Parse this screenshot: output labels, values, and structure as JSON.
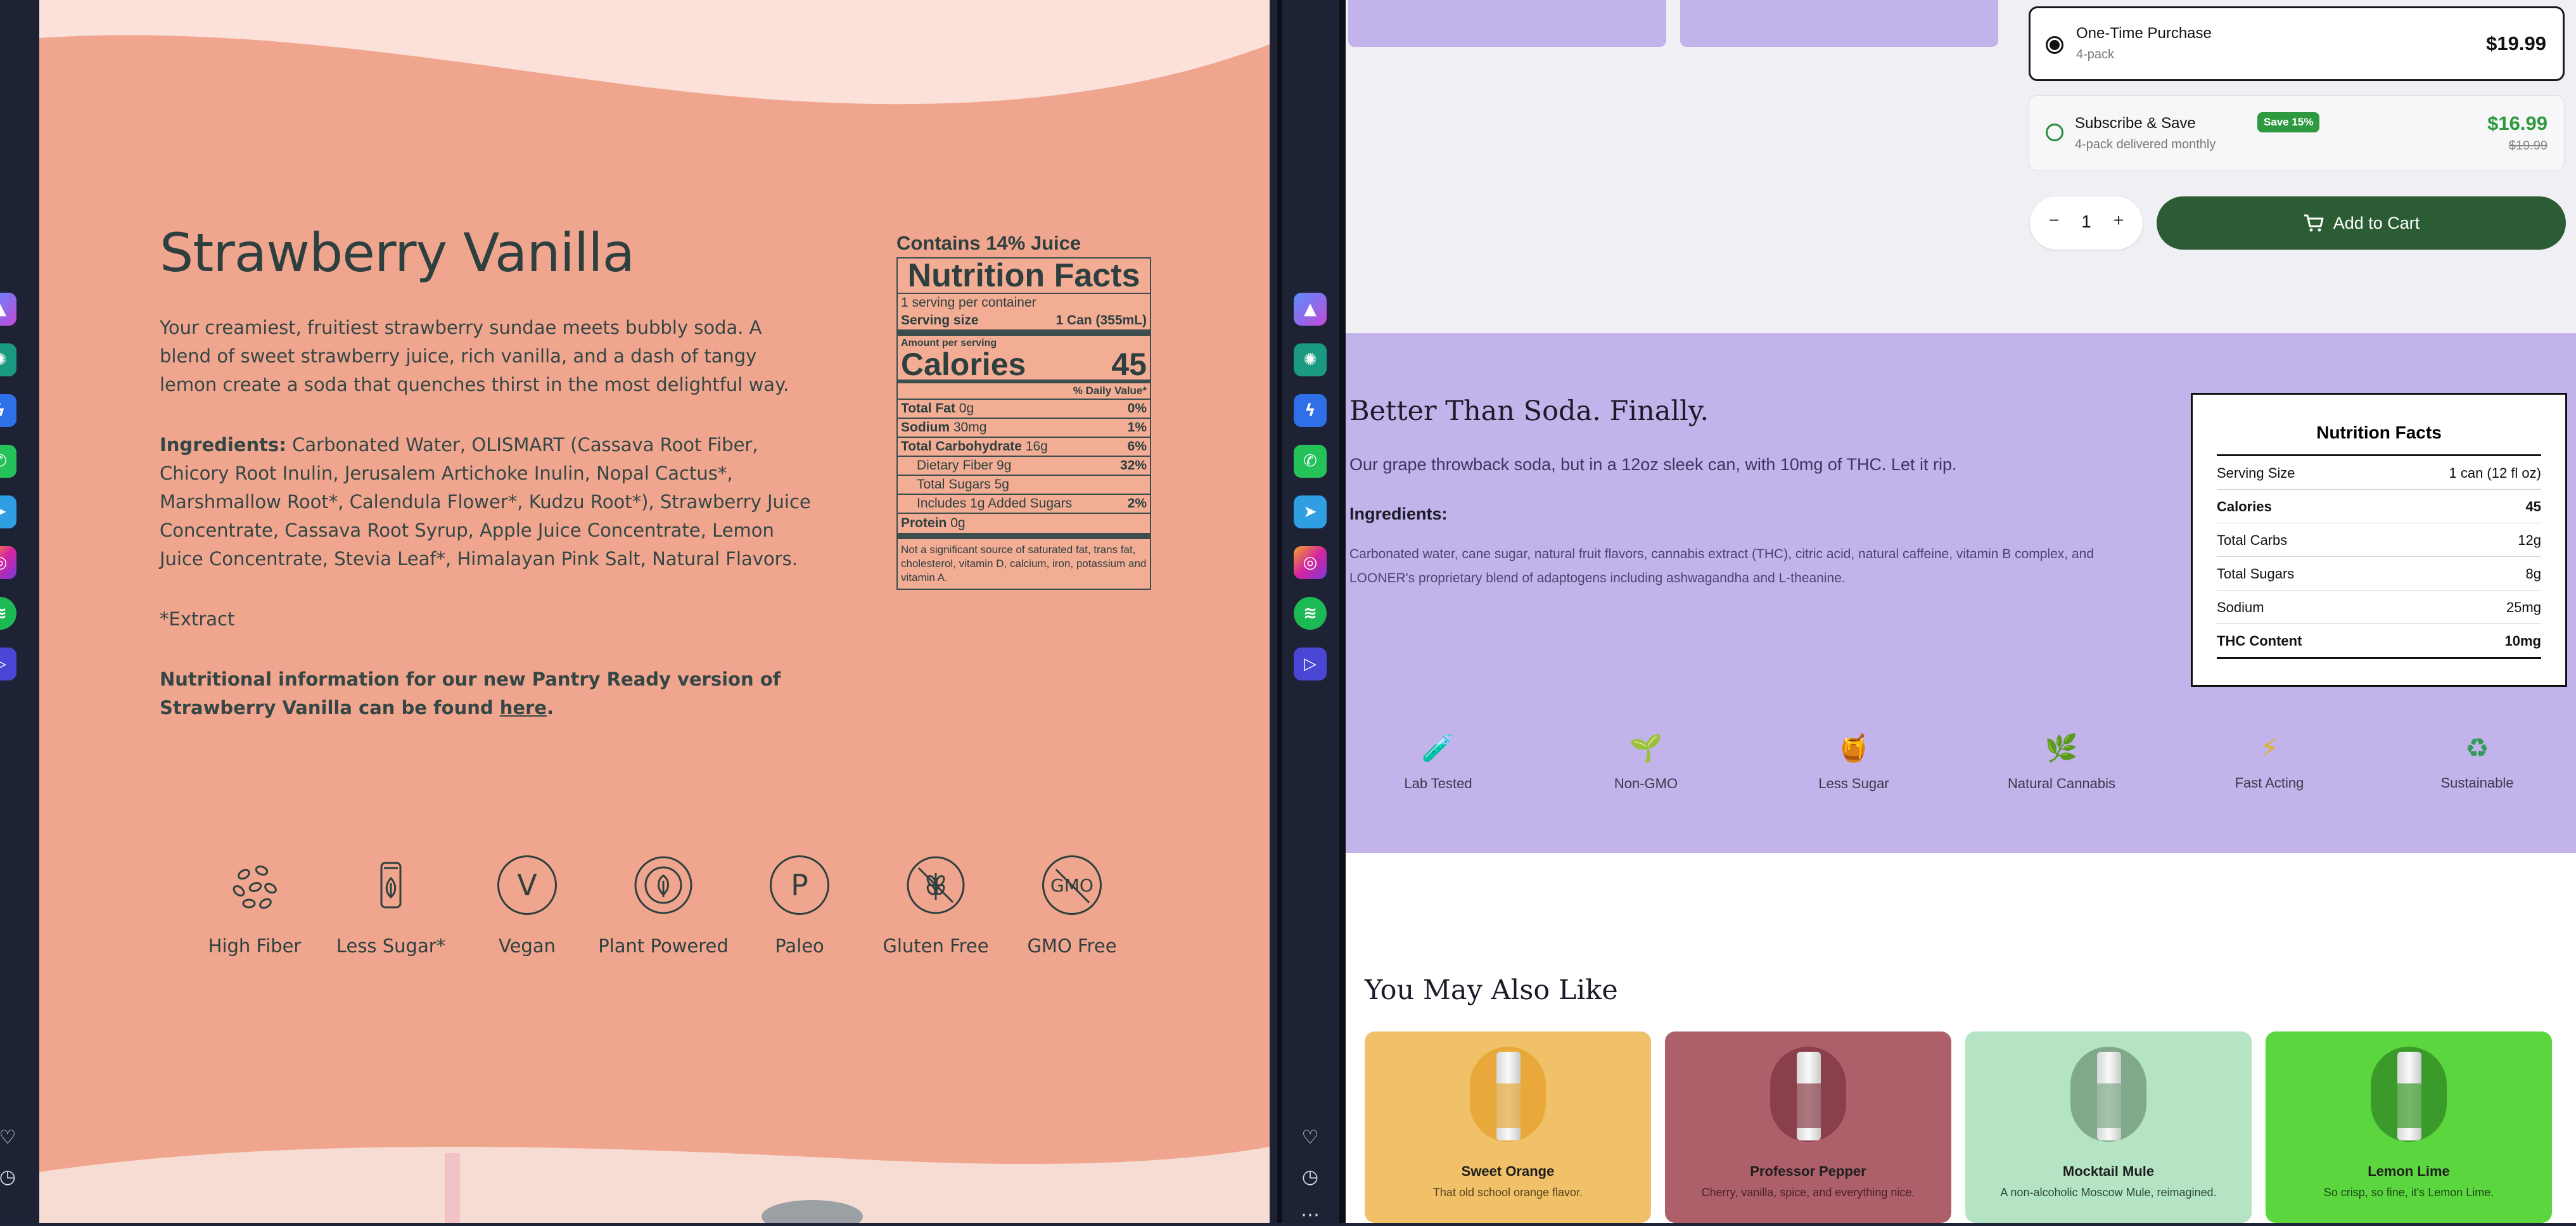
{
  "left": {
    "title": "Strawberry Vanilla",
    "description": "Your creamiest, fruitiest strawberry sundae meets bubbly soda. A blend of sweet strawberry juice, rich vanilla, and a dash of tangy lemon create a soda that quenches thirst in the most delightful way.",
    "ingredients_label": "Ingredients:",
    "ingredients": "Carbonated Water, OLISMART (Cassava Root Fiber, Chicory Root Inulin, Jerusalem Artichoke Inulin, Nopal Cactus*, Marshmallow Root*, Calendula Flower*, Kudzu Root*), Strawberry Juice Concentrate, Cassava Root Syrup, Apple Juice Concentrate, Lemon Juice Concentrate, Stevia Leaf*, Himalayan Pink Salt, Natural Flavors.",
    "extract_note": "*Extract",
    "pantry_note": "Nutritional information for our new Pantry Ready version of Strawberry Vanilla can be found",
    "pantry_link": "here",
    "pantry_period": ".",
    "nutrition": {
      "juice": "Contains 14% Juice",
      "title": "Nutrition Facts",
      "servings": "1 serving per container",
      "serving_size_label": "Serving size",
      "serving_size_value": "1 Can (355mL)",
      "amount_per_serving": "Amount per serving",
      "calories_label": "Calories",
      "calories_value": "45",
      "daily_value": "% Daily Value*",
      "rows": [
        {
          "label": "Total Fat",
          "amount": "0g",
          "dv": "0%",
          "indent": false
        },
        {
          "label": "Sodium",
          "amount": "30mg",
          "dv": "1%",
          "indent": false
        },
        {
          "label": "Total Carbohydrate",
          "amount": "16g",
          "dv": "6%",
          "indent": false
        },
        {
          "label": "Dietary Fiber",
          "amount": "9g",
          "dv": "32%",
          "indent": true
        },
        {
          "label": "Total Sugars",
          "amount": "5g",
          "dv": "",
          "indent": true
        },
        {
          "label": "Includes 1g Added Sugars",
          "amount": "",
          "dv": "2%",
          "indent": true
        }
      ],
      "protein_label": "Protein",
      "protein_value": "0g",
      "footnote": "Not a significant source of saturated fat, trans fat, cholesterol, vitamin D, calcium, iron, potassium and vitamin A."
    },
    "badges": [
      {
        "label": "High Fiber",
        "icon": "fiber-icon"
      },
      {
        "label": "Less Sugar*",
        "icon": "can-leaf-icon"
      },
      {
        "label": "Vegan",
        "icon": "vegan-v-icon",
        "glyph": "V"
      },
      {
        "label": "Plant Powered",
        "icon": "plant-powered-seal-icon"
      },
      {
        "label": "Paleo",
        "icon": "paleo-p-icon",
        "glyph": "P"
      },
      {
        "label": "Gluten Free",
        "icon": "gluten-free-icon"
      },
      {
        "label": "GMO Free",
        "icon": "gmo-free-icon",
        "glyph": "GMO"
      }
    ]
  },
  "right": {
    "purchase": {
      "one_time_label": "One-Time Purchase",
      "one_time_sub": "4-pack",
      "one_time_price": "$19.99",
      "subscribe_label": "Subscribe & Save",
      "subscribe_badge": "Save 15%",
      "subscribe_sub": "4-pack delivered monthly",
      "subscribe_price": "$16.99",
      "subscribe_old_price": "$19.99",
      "quantity": "1",
      "minus": "−",
      "plus": "+",
      "add_to_cart": "Add to Cart"
    },
    "about": {
      "heading": "Better Than Soda. Finally.",
      "tagline": "Our grape throwback soda, but in a 12oz sleek can, with 10mg of THC. Let it rip.",
      "ingredients_label": "Ingredients:",
      "ingredients": "Carbonated water, cane sugar, natural fruit flavors, cannabis extract (THC), citric acid, natural caffeine, vitamin B complex, and LOONER's proprietary blend of adaptogens including ashwagandha and L-theanine."
    },
    "nutrition": {
      "title": "Nutrition Facts",
      "rows": [
        {
          "label": "Serving Size",
          "value": "1 can (12 fl oz)"
        },
        {
          "label": "Calories",
          "value": "45"
        },
        {
          "label": "Total Carbs",
          "value": "12g"
        },
        {
          "label": "Total Sugars",
          "value": "8g"
        },
        {
          "label": "Sodium",
          "value": "25mg"
        },
        {
          "label": "THC Content",
          "value": "10mg"
        }
      ]
    },
    "features": [
      {
        "label": "Lab Tested",
        "icon": "test-tube-icon",
        "glyph": "🧪"
      },
      {
        "label": "Non-GMO",
        "icon": "seedling-icon",
        "glyph": "🌱"
      },
      {
        "label": "Less Sugar",
        "icon": "honey-pot-icon",
        "glyph": "🍯"
      },
      {
        "label": "Natural Cannabis",
        "icon": "herb-icon",
        "glyph": "🌿"
      },
      {
        "label": "Fast Acting",
        "icon": "lightning-icon",
        "glyph": "⚡"
      },
      {
        "label": "Sustainable",
        "icon": "recycle-icon",
        "glyph": "♻"
      }
    ],
    "related_heading": "You May Also Like",
    "related": [
      {
        "name": "Sweet Orange",
        "desc": "That old school orange flavor.",
        "bg": "#f0c168",
        "can": "#e8a93a",
        "desc_color": "#5a4420"
      },
      {
        "name": "Professor Pepper",
        "desc": "Cherry, vanilla, spice, and everything nice.",
        "bg": "#ad5f6a",
        "can": "#8a3f4a",
        "desc_color": "#4c2128"
      },
      {
        "name": "Mocktail Mule",
        "desc": "A non-alcoholic Moscow Mule, reimagined.",
        "bg": "#b5e4c4",
        "can": "#7fa98a",
        "desc_color": "#2c4a36"
      },
      {
        "name": "Lemon Lime",
        "desc": "So crisp, so fine, it's Lemon Lime.",
        "bg": "#5bd63e",
        "can": "#3a9b2a",
        "desc_color": "#1e4a16"
      }
    ]
  },
  "colors": {
    "left_bg": "#f0a68e",
    "right_accent": "#c2b3ea",
    "cart_green": "#2b5c33",
    "dock": "#1d2335"
  }
}
